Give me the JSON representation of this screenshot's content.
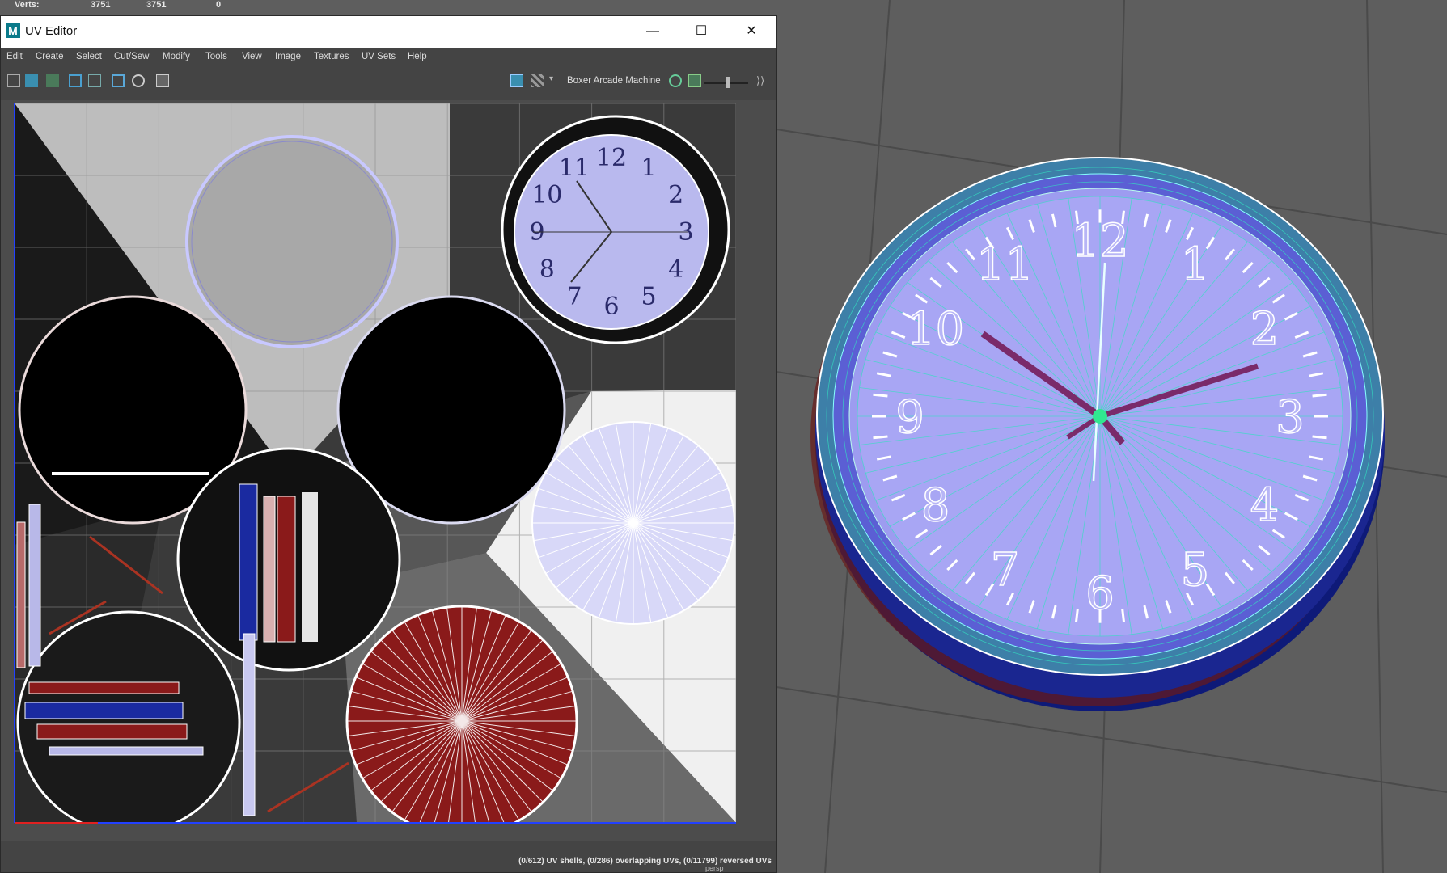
{
  "hud": {
    "verts_label": "Verts:",
    "verts_a": "3751",
    "verts_b": "3751",
    "verts_c": "0"
  },
  "window": {
    "title": "UV Editor",
    "app_icon": "M",
    "minimize": "—",
    "maximize": "☐",
    "close": "✕"
  },
  "menu": [
    "Edit",
    "Create",
    "Select",
    "Cut/Sew",
    "Modify",
    "Tools",
    "View",
    "Image",
    "Textures",
    "UV Sets",
    "Help"
  ],
  "toolbar": {
    "texture_name": "Boxer Arcade Machine"
  },
  "status": {
    "text": "(0/612) UV shells, (0/286) overlapping UVs, (0/11799) reversed UVs"
  },
  "bottom_note": "persp",
  "clock": {
    "numerals": [
      "12",
      "1",
      "2",
      "3",
      "4",
      "5",
      "6",
      "7",
      "8",
      "9",
      "10",
      "11"
    ]
  },
  "colors": {
    "accent_teal": "#30d9b0",
    "face_lilac": "#a9a6f2",
    "uv_red": "#8a1a1a",
    "uv_blue": "#1d2a9a"
  }
}
